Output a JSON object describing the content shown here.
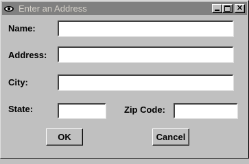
{
  "window": {
    "title": "Enter an Address"
  },
  "titlebar": {
    "icon": "eye-icon",
    "minimize_icon": "minimize-icon",
    "maximize_icon": "maximize-icon",
    "close_icon": "close-icon",
    "close_glyph": "×"
  },
  "form": {
    "name_label": "Name:",
    "name_value": "",
    "address_label": "Address:",
    "address_value": "",
    "city_label": "City:",
    "city_value": "",
    "state_label": "State:",
    "state_value": "",
    "zip_label": "Zip Code:",
    "zip_value": ""
  },
  "buttons": {
    "ok_label": "OK",
    "cancel_label": "Cancel"
  },
  "colors": {
    "window_bg": "#c0c0c0",
    "titlebar_inactive": "#808080",
    "title_text": "#d4d0c8",
    "field_bg": "#ffffff"
  }
}
